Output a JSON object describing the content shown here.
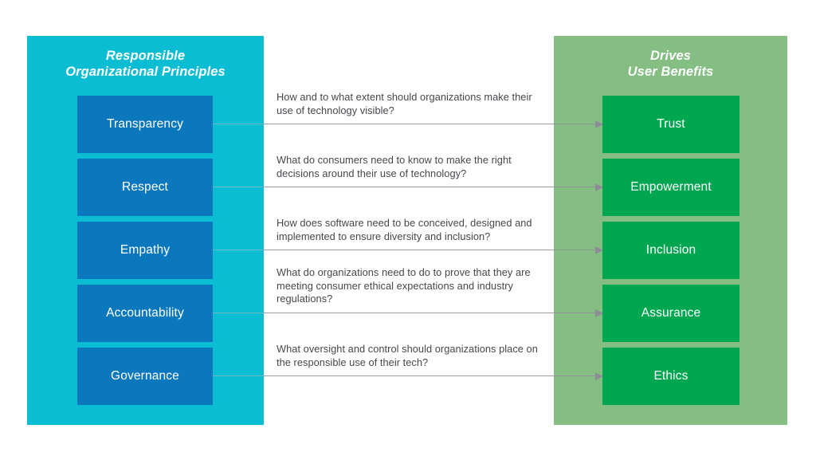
{
  "diagram": {
    "left_panel": {
      "title": "Responsible\nOrganizational Principles",
      "color": "#0bbdd3",
      "box_color": "#0b77bd"
    },
    "right_panel": {
      "title": "Drives\nUser Benefits",
      "color": "#84be83",
      "box_color": "#00a650"
    },
    "connector_color": "#8c8c96",
    "rows": [
      {
        "principle": "Transparency",
        "question": "How and to what extent should organizations make their use of technology visible?",
        "benefit": "Trust"
      },
      {
        "principle": "Respect",
        "question": "What do consumers need to know to make the right decisions around their use of technology?",
        "benefit": "Empowerment"
      },
      {
        "principle": "Empathy",
        "question": "How does software need to be conceived, designed and implemented to ensure diversity and inclusion?",
        "benefit": "Inclusion"
      },
      {
        "principle": "Accountability",
        "question": "What do organizations need to do to prove that they are meeting consumer ethical expectations and industry regulations?",
        "benefit": "Assurance"
      },
      {
        "principle": "Governance",
        "question": "What oversight and control should organizations place on the responsible use of their tech?",
        "benefit": "Ethics"
      }
    ]
  }
}
